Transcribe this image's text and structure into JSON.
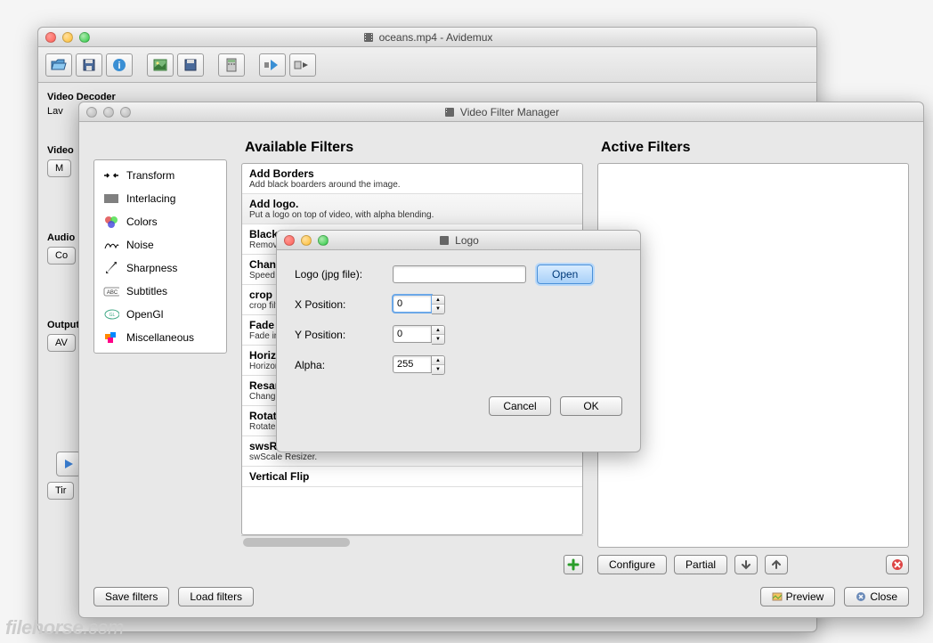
{
  "main_window": {
    "title": "oceans.mp4 - Avidemux",
    "sections": {
      "video_decoder": "Video Decoder",
      "lav": "Lav",
      "video": "Video",
      "m_btn": "M",
      "audio": "Audio",
      "co_btn": "Co",
      "output": "Output",
      "av_btn": "AV",
      "tir_btn": "Tir"
    }
  },
  "filter_manager": {
    "title": "Video Filter Manager",
    "available_heading": "Available Filters",
    "active_heading": "Active Filters",
    "categories": [
      {
        "label": "Transform",
        "icon": "transform"
      },
      {
        "label": "Interlacing",
        "icon": "interlacing"
      },
      {
        "label": "Colors",
        "icon": "colors"
      },
      {
        "label": "Noise",
        "icon": "noise"
      },
      {
        "label": "Sharpness",
        "icon": "sharpness"
      },
      {
        "label": "Subtitles",
        "icon": "subtitles"
      },
      {
        "label": "OpenGl",
        "icon": "opengl"
      },
      {
        "label": "Miscellaneous",
        "icon": "misc"
      }
    ],
    "filters": [
      {
        "title": "Add Borders",
        "desc": "Add black boarders around the image."
      },
      {
        "title": "Add logo.",
        "desc": "Put a logo on top of video, with alpha blending."
      },
      {
        "title": "Blacken Bo",
        "desc": "Remove noisy"
      },
      {
        "title": "Change FP",
        "desc": "Speed up/slow"
      },
      {
        "title": "crop",
        "desc": "crop filter"
      },
      {
        "title": "Fade",
        "desc": "Fade in/out."
      },
      {
        "title": "Horizontal",
        "desc": "Horizontally fl"
      },
      {
        "title": "Resample",
        "desc": "Change and er"
      },
      {
        "title": "Rotate",
        "desc": "Rotate the ima"
      },
      {
        "title": "swsResize",
        "desc": "swScale Resizer."
      },
      {
        "title": "Vertical Flip",
        "desc": ""
      }
    ],
    "buttons": {
      "configure": "Configure",
      "partial": "Partial",
      "save_filters": "Save filters",
      "load_filters": "Load filters",
      "preview": "Preview",
      "close": "Close"
    }
  },
  "logo_dialog": {
    "title": "Logo",
    "labels": {
      "file": "Logo (jpg file):",
      "xpos": "X Position:",
      "ypos": "Y Position:",
      "alpha": "Alpha:"
    },
    "values": {
      "file": "",
      "xpos": "0",
      "ypos": "0",
      "alpha": "255"
    },
    "buttons": {
      "open": "Open",
      "cancel": "Cancel",
      "ok": "OK"
    }
  },
  "watermark": {
    "name": "filehorse",
    "ext": ".com"
  }
}
